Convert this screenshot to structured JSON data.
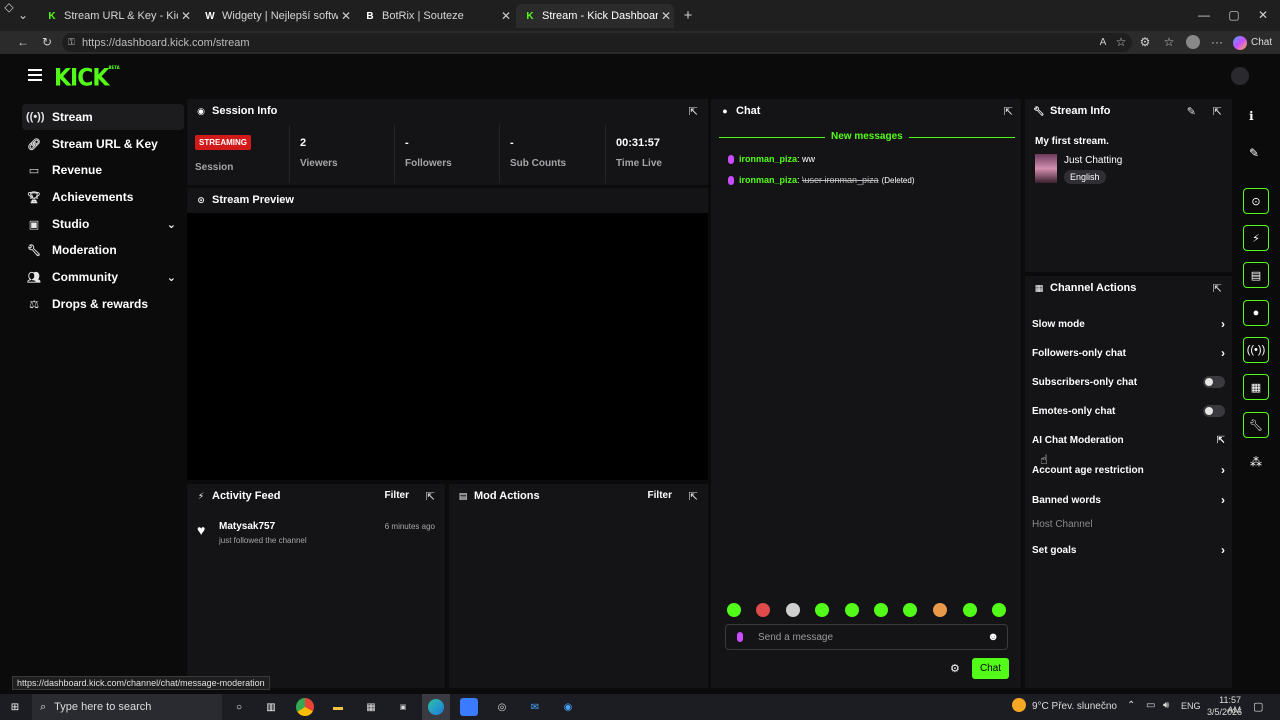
{
  "browser": {
    "tabs": [
      {
        "title": "Stream URL & Key - Kick Dashboa",
        "favicon": "K"
      },
      {
        "title": "Widgety | Nejlepší software pro v",
        "favicon": "W"
      },
      {
        "title": "BotRix | Souteze",
        "favicon": "B"
      },
      {
        "title": "Stream - Kick Dashboard",
        "favicon": "K"
      }
    ],
    "url": "https://dashboard.kick.com/stream",
    "chat_button": "Chat",
    "status_url": "https://dashboard.kick.com/channel/chat/message-moderation"
  },
  "kick": {
    "logo": "KICK",
    "logo_sup": "BETA",
    "accent": "#53fc18"
  },
  "sidebar": {
    "items": [
      {
        "label": "Stream",
        "icon": "stream-icon"
      },
      {
        "label": "Stream URL & Key",
        "icon": "link-icon"
      },
      {
        "label": "Revenue",
        "icon": "dollar-icon"
      },
      {
        "label": "Achievements",
        "icon": "trophy-icon"
      },
      {
        "label": "Studio",
        "icon": "studio-icon"
      },
      {
        "label": "Moderation",
        "icon": "wrench-icon"
      },
      {
        "label": "Community",
        "icon": "people-icon"
      },
      {
        "label": "Drops & rewards",
        "icon": "drops-icon"
      }
    ]
  },
  "session": {
    "title": "Session Info",
    "badge": "STREAMING",
    "session_label": "Session",
    "viewers": "2",
    "viewers_label": "Viewers",
    "followers": "-",
    "followers_label": "Followers",
    "subs": "-",
    "subs_label": "Sub Counts",
    "time": "00:31:57",
    "time_label": "Time Live"
  },
  "preview": {
    "title": "Stream Preview"
  },
  "activity": {
    "title": "Activity Feed",
    "filter": "Filter",
    "items": [
      {
        "user": "Matysak757",
        "text": "just followed the channel",
        "time": "6 minutes ago"
      }
    ]
  },
  "mod": {
    "title": "Mod Actions",
    "filter": "Filter"
  },
  "chat": {
    "title": "Chat",
    "new_messages": "New messages",
    "messages": [
      {
        "user": "ironman_piza",
        "text": ": ww"
      },
      {
        "user": "ironman_piza",
        "text": ": ",
        "deleted_text": "\\user ironman_piza",
        "deleted_tag": "(Deleted)"
      }
    ],
    "placeholder": "Send a message",
    "send": "Chat"
  },
  "streaminfo": {
    "title": "Stream Info",
    "stream_title": "My first stream.",
    "category": "Just Chatting",
    "language": "English"
  },
  "channel_actions": {
    "title": "Channel Actions",
    "items": [
      {
        "label": "Slow mode",
        "control": "chevron"
      },
      {
        "label": "Followers-only chat",
        "control": "chevron"
      },
      {
        "label": "Subscribers-only chat",
        "control": "toggle"
      },
      {
        "label": "Emotes-only chat",
        "control": "toggle"
      },
      {
        "label": "AI Chat Moderation",
        "control": "external"
      },
      {
        "label": "Account age restriction",
        "control": "chevron"
      },
      {
        "label": "Banned words",
        "control": "chevron"
      },
      {
        "label": "Host Channel",
        "control": "none"
      },
      {
        "label": "Set goals",
        "control": "chevron"
      }
    ]
  },
  "taskbar": {
    "search": "Type here to search",
    "weather": "9°C  Přev. slunečno",
    "lang": "ENG",
    "time": "11:57 AM",
    "date": "3/5/2026"
  }
}
